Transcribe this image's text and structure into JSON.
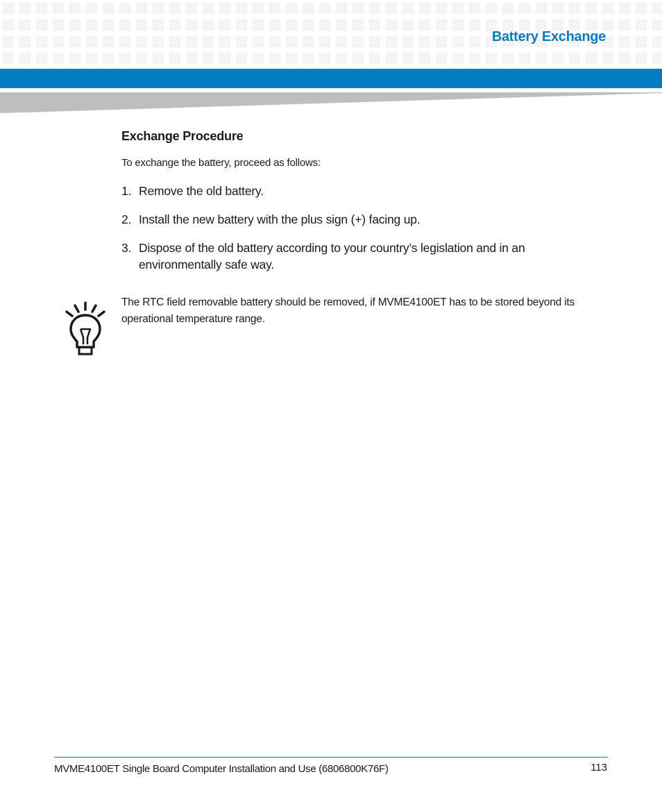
{
  "header": {
    "section_title": "Battery Exchange",
    "accent_color": "#027dbf"
  },
  "content": {
    "heading": "Exchange Procedure",
    "intro": "To exchange the battery, proceed as follows:",
    "steps": [
      {
        "number": "1.",
        "text": "Remove the old battery."
      },
      {
        "number": "2.",
        "text": "Install the new battery with the plus sign (+) facing up."
      },
      {
        "number": "3.",
        "text": "Dispose of the old battery according to your country’s legislation and in an environmentally safe way."
      }
    ],
    "note": {
      "icon": "lightbulb-icon",
      "text": "The RTC field removable battery should be removed, if MVME4100ET has to be stored beyond its operational temperature range."
    }
  },
  "footer": {
    "document_title": "MVME4100ET Single Board Computer Installation and Use (6806800K76F)",
    "page_number": "113"
  }
}
